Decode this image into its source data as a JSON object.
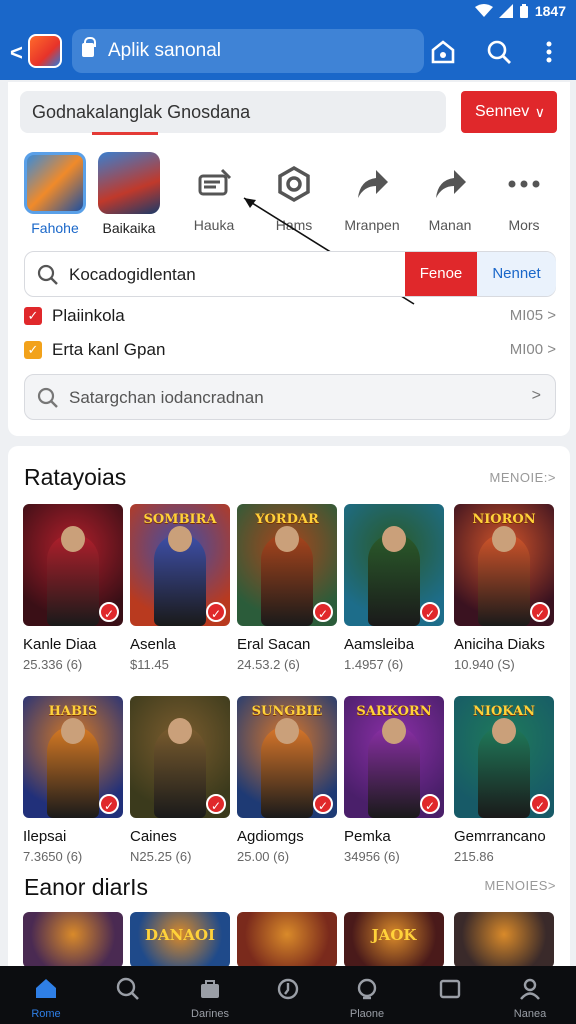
{
  "status": {
    "time": "1847"
  },
  "appbar": {
    "back": "<",
    "url": "Aplik sanonal"
  },
  "search": {
    "value": "Godnakalanglak Gnosdana",
    "button": "Sennev",
    "button_chevron": "∨"
  },
  "quick": [
    {
      "label": "Fahohe",
      "icon": "app-icon"
    },
    {
      "label": "Baikaika",
      "icon": "game-icon"
    },
    {
      "label": "Hauka",
      "icon": "tag-icon"
    },
    {
      "label": "Hams",
      "icon": "swirl-icon"
    },
    {
      "label": "Mranpen",
      "icon": "share-icon"
    },
    {
      "label": "Manan",
      "icon": "share-icon"
    },
    {
      "label": "Mors",
      "icon": "more-icon"
    }
  ],
  "search2": {
    "value": "Kocadogidlentan",
    "btn1": "Fenoe",
    "btn2": "Nennet"
  },
  "checks": [
    {
      "label": "Plaiinkola",
      "value": "MI05",
      "color": "#e0282b"
    },
    {
      "label": "Erta kanl Gpan",
      "value": "MI00",
      "color": "#f2a21b"
    }
  ],
  "search3": {
    "placeholder": "Satargchan iodancradnan",
    "chevron": ">"
  },
  "section1": {
    "title": "Ratayoias",
    "more": "MENOIE:>"
  },
  "section2": {
    "title": "Eanor diarIs",
    "more": "MENOIES>"
  },
  "games_row1": [
    {
      "name": "Kanle Diaa",
      "meta": "25.336 (6)",
      "banner": "",
      "bg": "#3a0f16",
      "accent": "#b01f2b"
    },
    {
      "name": "Asenla",
      "meta": "$11.45",
      "banner": "SOMBIRA",
      "bg": "#b93a1f",
      "accent": "#3e4fa8"
    },
    {
      "name": "Eral Sacan",
      "meta": "24.53.2 (6)",
      "banner": "YORDAR",
      "bg": "#2b5c3a",
      "accent": "#a8451c"
    },
    {
      "name": "Aamsleiba",
      "meta": "1.4957 (6)",
      "banner": "",
      "bg": "#1d6d8a",
      "accent": "#2a5a2a"
    },
    {
      "name": "Aniciha Diaks",
      "meta": "10.940 (S)",
      "banner": "NIORON",
      "bg": "#3a1220",
      "accent": "#d0542a"
    }
  ],
  "games_row2": [
    {
      "name": "Ilepsai",
      "meta": "7.3650 (6)",
      "banner": "HABIS",
      "bg": "#21307a",
      "accent": "#d77a24"
    },
    {
      "name": "Caines",
      "meta": "N25.25 (6)",
      "banner": "",
      "bg": "#3b3a1c",
      "accent": "#7a5c2e"
    },
    {
      "name": "Agdiomgs",
      "meta": "25.00 (6)",
      "banner": "SUNGBIE",
      "bg": "#1e3a74",
      "accent": "#d9772a"
    },
    {
      "name": "Pemka",
      "meta": "34956 (6)",
      "banner": "SARKORN",
      "bg": "#4a1f6a",
      "accent": "#8a2fa6"
    },
    {
      "name": "Gemrrancano",
      "meta": "215.86",
      "banner": "NIOKAN",
      "bg": "#175a67",
      "accent": "#1f7a5a"
    }
  ],
  "games_row3": [
    {
      "banner": "",
      "bg": "#4a2a52"
    },
    {
      "banner": "DANAOI",
      "bg": "#1f4a8a"
    },
    {
      "banner": "",
      "bg": "#7a2a1c"
    },
    {
      "banner": "JAOK",
      "bg": "#4a1a1a"
    },
    {
      "banner": "",
      "bg": "#3a2a2a"
    }
  ],
  "checkmark": "✓",
  "nav": [
    {
      "label": "Rome",
      "icon": "home-icon",
      "active": true
    },
    {
      "label": "",
      "icon": "search-icon",
      "active": false
    },
    {
      "label": "Darines",
      "icon": "bag-icon",
      "active": false
    },
    {
      "label": "",
      "icon": "clock-icon",
      "active": false
    },
    {
      "label": "Plaone",
      "icon": "search-alt-icon",
      "active": false
    },
    {
      "label": "",
      "icon": "window-icon",
      "active": false
    },
    {
      "label": "Nanea",
      "icon": "user-icon",
      "active": false
    }
  ],
  "colors": {
    "brand": "#1a67c9",
    "accent": "#e0282b"
  }
}
